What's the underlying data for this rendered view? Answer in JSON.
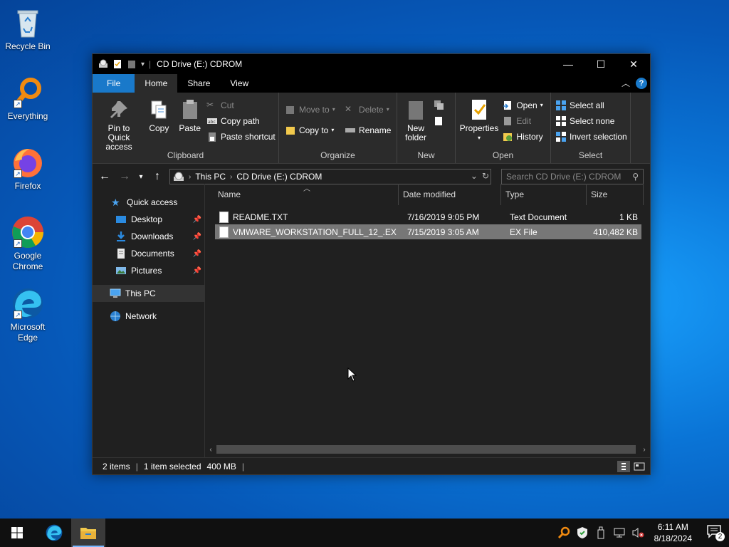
{
  "desktop": {
    "icons": [
      {
        "label": "Recycle Bin",
        "icon": "recycle-bin-icon"
      },
      {
        "label": "Everything",
        "icon": "everything-search-icon"
      },
      {
        "label": "Firefox",
        "icon": "firefox-icon"
      },
      {
        "label": "Google Chrome",
        "icon": "chrome-icon"
      },
      {
        "label": "Microsoft Edge",
        "icon": "edge-icon"
      }
    ]
  },
  "window": {
    "title": "CD Drive (E:) CDROM",
    "controls": {
      "minimize": "—",
      "maximize": "☐",
      "close": "✕"
    }
  },
  "ribbon_tabs": {
    "file": "File",
    "home": "Home",
    "share": "Share",
    "view": "View"
  },
  "ribbon": {
    "clipboard": {
      "label": "Clipboard",
      "pin": "Pin to Quick access",
      "copy": "Copy",
      "paste": "Paste",
      "cut": "Cut",
      "copy_path": "Copy path",
      "paste_shortcut": "Paste shortcut"
    },
    "organize": {
      "label": "Organize",
      "move_to": "Move to",
      "copy_to": "Copy to",
      "delete": "Delete",
      "rename": "Rename"
    },
    "new": {
      "label": "New",
      "new_folder": "New folder"
    },
    "open": {
      "label": "Open",
      "properties": "Properties",
      "open": "Open",
      "edit": "Edit",
      "history": "History"
    },
    "select": {
      "label": "Select",
      "select_all": "Select all",
      "select_none": "Select none",
      "invert": "Invert selection"
    }
  },
  "address": {
    "segments": [
      "This PC",
      "CD Drive (E:) CDROM"
    ],
    "search_placeholder": "Search CD Drive (E:) CDROM"
  },
  "navpane": {
    "quick_access": "Quick access",
    "items": [
      "Desktop",
      "Downloads",
      "Documents",
      "Pictures"
    ],
    "this_pc": "This PC",
    "network": "Network"
  },
  "columns": {
    "name": "Name",
    "date": "Date modified",
    "type": "Type",
    "size": "Size"
  },
  "files": [
    {
      "name": "README.TXT",
      "date": "7/16/2019 9:05 PM",
      "type": "Text Document",
      "size": "1 KB"
    },
    {
      "name": "VMWARE_WORKSTATION_FULL_12_.EX",
      "date": "7/15/2019 3:05 AM",
      "type": "EX File",
      "size": "410,482 KB"
    }
  ],
  "status": {
    "items": "2 items",
    "selected": "1 item selected",
    "size": "400 MB"
  },
  "taskbar": {
    "time": "6:11 AM",
    "date": "8/18/2024",
    "notification_count": "2"
  }
}
